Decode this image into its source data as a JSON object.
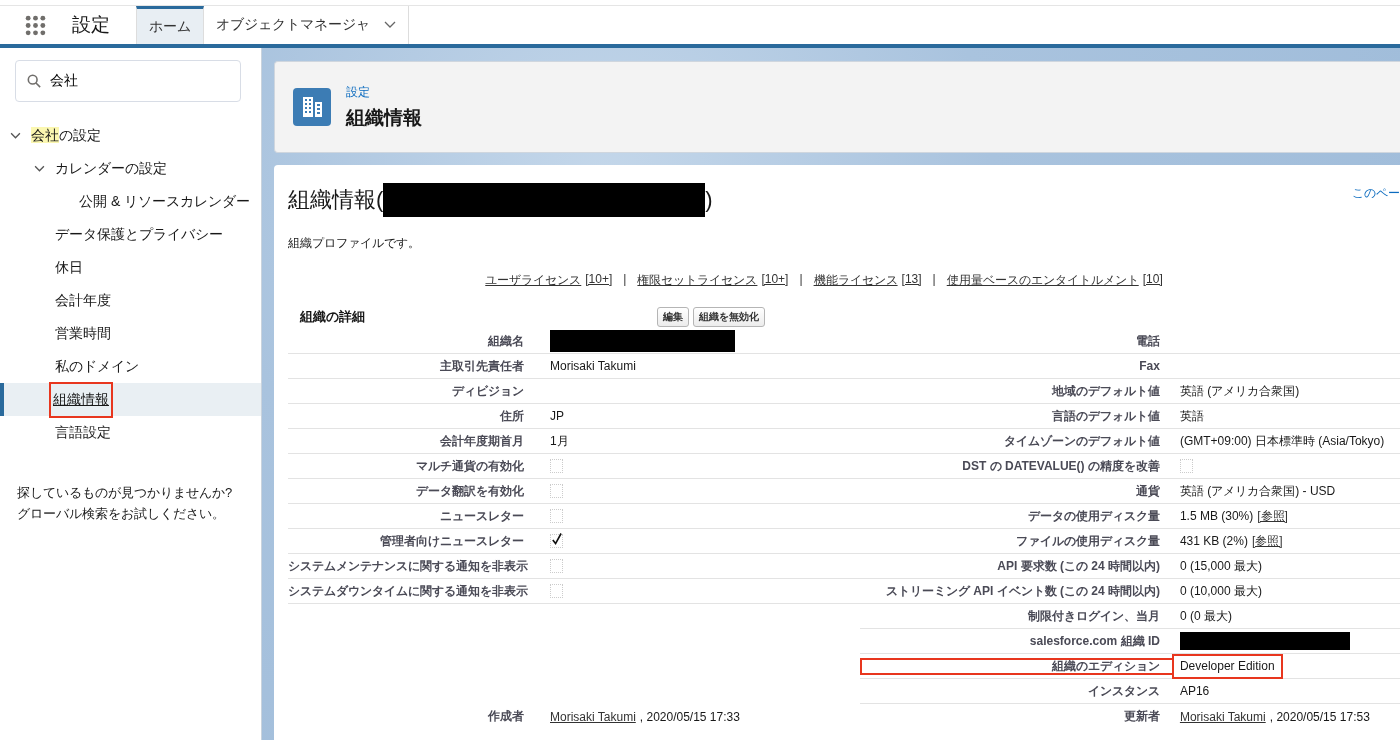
{
  "app_bar": {
    "title": "設定",
    "tabs": [
      {
        "label": "ホーム",
        "selected": true,
        "dropdown": false
      },
      {
        "label": "オブジェクトマネージャ",
        "selected": false,
        "dropdown": true
      }
    ]
  },
  "sidebar": {
    "search": {
      "value": "会社"
    },
    "tree": [
      {
        "match": "会社",
        "rest": "の設定",
        "expanded": true,
        "selected": false,
        "annotated": false,
        "children": [
          {
            "rest": "カレンダーの設定",
            "expanded": true,
            "selected": false,
            "annotated": false,
            "children": [
              {
                "rest": "公開 & リソースカレンダー",
                "selected": false,
                "annotated": false
              }
            ]
          },
          {
            "rest": "データ保護とプライバシー",
            "selected": false,
            "annotated": false
          },
          {
            "rest": "休日",
            "selected": false,
            "annotated": false
          },
          {
            "rest": "会計年度",
            "selected": false,
            "annotated": false
          },
          {
            "rest": "営業時間",
            "selected": false,
            "annotated": false
          },
          {
            "rest": "私のドメイン",
            "selected": false,
            "annotated": false
          },
          {
            "rest": "組織情報",
            "selected": true,
            "annotated": true
          },
          {
            "rest": "言語設定",
            "selected": false,
            "annotated": false
          }
        ]
      }
    ],
    "help": "探しているものが見つかりませんか?\nグローバル検索をお試しください。"
  },
  "header": {
    "breadcrumb": "設定",
    "title": "組織情報"
  },
  "page": {
    "title_prefix": "組織情報(",
    "title_redacted": true,
    "title_suffix": ")",
    "help_link": "このペー",
    "description": "組織プロファイルです。",
    "license_separator": "|",
    "licenses": [
      {
        "label": "ユーザライセンス",
        "count": "[10+]"
      },
      {
        "label": "権限セットライセンス",
        "count": "[10+]"
      },
      {
        "label": "機能ライセンス",
        "count": "[13]"
      },
      {
        "label": "使用量ベースのエンタイトルメント",
        "count": "[10]"
      }
    ],
    "section": {
      "title": "組織の詳細",
      "buttons": [
        "編集",
        "組織を無効化"
      ]
    },
    "left_fields": [
      {
        "label": "組織名",
        "kind": "redacted",
        "annotated": false
      },
      {
        "label": "主取引先責任者",
        "kind": "text",
        "value": "Morisaki Takumi",
        "annotated": false
      },
      {
        "label": "ディビジョン",
        "kind": "empty",
        "annotated": false
      },
      {
        "label": "住所",
        "kind": "text",
        "value": "JP",
        "annotated": false
      },
      {
        "label": "会計年度期首月",
        "kind": "text",
        "value": "1月",
        "annotated": false
      },
      {
        "label": "マルチ通貨の有効化",
        "kind": "checkbox",
        "checked": false,
        "annotated": false
      },
      {
        "label": "データ翻訳を有効化",
        "kind": "checkbox",
        "checked": false,
        "annotated": false
      },
      {
        "label": "ニュースレター",
        "kind": "checkbox",
        "checked": false,
        "annotated": false
      },
      {
        "label": "管理者向けニュースレター",
        "kind": "checkbox",
        "checked": true,
        "annotated": false
      },
      {
        "label": "システムメンテナンスに関する通知を非表示",
        "kind": "checkbox",
        "checked": false,
        "annotated": false
      },
      {
        "label": "システムダウンタイムに関する通知を非表示",
        "kind": "checkbox",
        "checked": false,
        "annotated": false
      }
    ],
    "right_fields": [
      {
        "label": "電話",
        "kind": "empty",
        "annotated": false
      },
      {
        "label": "Fax",
        "kind": "empty",
        "annotated": false
      },
      {
        "label": "地域のデフォルト値",
        "kind": "text",
        "value": "英語 (アメリカ合衆国)",
        "annotated": false
      },
      {
        "label": "言語のデフォルト値",
        "kind": "text",
        "value": "英語",
        "annotated": false
      },
      {
        "label": "タイムゾーンのデフォルト値",
        "kind": "text",
        "value": "(GMT+09:00) 日本標準時 (Asia/Tokyo)",
        "annotated": false
      },
      {
        "label": "DST の DATEVALUE() の精度を改善",
        "kind": "checkbox",
        "checked": false,
        "annotated": false
      },
      {
        "label": "通貨",
        "kind": "text",
        "value": "英語 (アメリカ合衆国) - USD",
        "annotated": false
      },
      {
        "label": "データの使用ディスク量",
        "kind": "link",
        "value": "1.5 MB (30%)",
        "link": "[参照]",
        "annotated": false
      },
      {
        "label": "ファイルの使用ディスク量",
        "kind": "link",
        "value": "431 KB (2%)",
        "link": "[参照]",
        "annotated": false
      },
      {
        "label": "API 要求数 (この 24 時間以内)",
        "kind": "text",
        "value": "0 (15,000 最大)",
        "annotated": false
      },
      {
        "label": "ストリーミング API イベント数 (この 24 時間以内)",
        "kind": "text",
        "value": "0 (10,000 最大)",
        "annotated": false
      },
      {
        "label": "制限付きログイン、当月",
        "kind": "text",
        "value": "0 (0 最大)",
        "annotated": false
      },
      {
        "label": "salesforce.com 組織 ID",
        "kind": "redacted",
        "annotated": false
      },
      {
        "label": "組織のエディション",
        "kind": "text",
        "value": "Developer Edition",
        "annotated": true
      },
      {
        "label": "インスタンス",
        "kind": "text",
        "value": "AP16",
        "annotated": false
      }
    ],
    "created": {
      "label": "作成者",
      "user": "Morisaki Takumi",
      "date": ", 2020/05/15 17:33"
    },
    "modified": {
      "label": "更新者",
      "user": "Morisaki Takumi",
      "date": ", 2020/05/15 17:53"
    }
  }
}
